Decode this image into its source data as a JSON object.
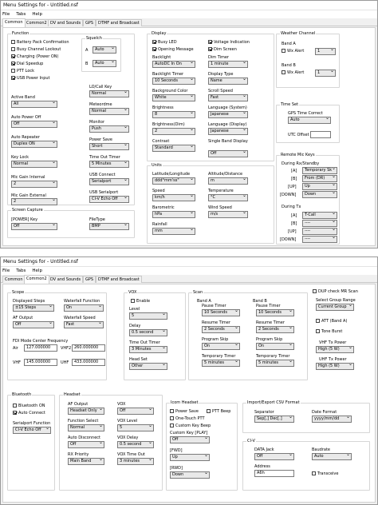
{
  "window1": {
    "title": "Menu Settings for - Untitled.nsf",
    "menu": [
      "File",
      "Tabs",
      "Help"
    ],
    "tabs": [
      "Common",
      "Common2",
      "DV and Sounds",
      "GPS",
      "DTMF and Broadcast"
    ],
    "function": {
      "title": "Function",
      "checks": [
        {
          "label": "Battery Pack Confirmation",
          "on": false
        },
        {
          "label": "Busy Channel Lockout",
          "on": false
        },
        {
          "label": "Charging (Power ON)",
          "on": true
        },
        {
          "label": "Dial Speedup",
          "on": true
        },
        {
          "label": "PTT Lock",
          "on": false
        },
        {
          "label": "USB Power Input",
          "on": true
        }
      ],
      "squelch": {
        "title": "Squelch",
        "a_label": "A",
        "a_value": "Auto",
        "b_label": "B",
        "b_value": "Auto"
      },
      "left": [
        {
          "label": "Active Band",
          "value": "All"
        },
        {
          "label": "Auto Power Off",
          "value": "Off"
        },
        {
          "label": "Auto Repeater",
          "value": "Duplex ON"
        },
        {
          "label": "Key Lock",
          "value": "Normal"
        },
        {
          "label": "Mic Gain Internal",
          "value": "2"
        },
        {
          "label": "Mic Gain External",
          "value": "2"
        }
      ],
      "right": [
        {
          "label": "LO/Call Key",
          "value": "Normal"
        },
        {
          "label": "Meteordme",
          "value": "Normal"
        },
        {
          "label": "Monitor",
          "value": "Push"
        },
        {
          "label": "Power Save",
          "value": "Short"
        },
        {
          "label": "Time Out Timer",
          "value": "5 Minutes"
        },
        {
          "label": "USB Connect",
          "value": "Serialport"
        },
        {
          "label": "USB Serialport",
          "value": "CI-V Echo Off"
        }
      ]
    },
    "screen_capture": {
      "title": "Screen Capture",
      "power_label": "[POWER] Key",
      "power_value": "Off",
      "filetype_label": "FileType",
      "filetype_value": "BMP"
    },
    "display": {
      "title": "Display",
      "checks": [
        {
          "label": "Busy LED",
          "on": true
        },
        {
          "label": "Voltage Indication",
          "on": true
        },
        {
          "label": "Opening Message",
          "on": true
        },
        {
          "label": "Dim Screen",
          "on": true
        }
      ],
      "left": [
        {
          "label": "Backlight",
          "value": "AutoDC In On"
        },
        {
          "label": "Backlight Timer",
          "value": "10 Seconds"
        },
        {
          "label": "Background Color",
          "value": "White"
        },
        {
          "label": "Brightness",
          "value": "8"
        },
        {
          "label": "Brightness(Dim)",
          "value": "2"
        },
        {
          "label": "Contrast",
          "value": "Standard"
        }
      ],
      "right": [
        {
          "label": "Dim Timer",
          "value": "1 minute"
        },
        {
          "label": "Display Type",
          "value": "Name"
        },
        {
          "label": "Scroll Speed",
          "value": "Fast"
        },
        {
          "label": "Language (System)",
          "value": "Japanese"
        },
        {
          "label": "Language (Display)",
          "value": "Japanese"
        },
        {
          "label": "Single Band Display",
          "value": "Off"
        }
      ]
    },
    "units": {
      "title": "Units",
      "left": [
        {
          "label": "Latitude/Longitude",
          "value": "ddd°mm'ss\""
        },
        {
          "label": "Speed",
          "value": "km/h"
        },
        {
          "label": "Barometric",
          "value": "hPa"
        },
        {
          "label": "Rainfall",
          "value": "mm"
        }
      ],
      "right": [
        {
          "label": "Altitude/Distance",
          "value": "m"
        },
        {
          "label": "Temperature",
          "value": "°C"
        },
        {
          "label": "Wind Speed",
          "value": "m/s"
        }
      ]
    },
    "weather": {
      "title": "Weather Channel",
      "band_a": "Band A",
      "band_b": "Band B",
      "wx_alert": "Wx Alert",
      "a_value": "1",
      "b_value": "1"
    },
    "time_set": {
      "title": "Time Set",
      "gps_label": "GPS Time Correct",
      "gps_value": "Auto",
      "utc_label": "UTC Offset",
      "utc_value": ""
    },
    "remote_mic": {
      "title": "Remote Mic Keys",
      "rx_title": "During Rx/Standby",
      "rx": [
        {
          "key": "[A]",
          "value": "Temporary Sk"
        },
        {
          "key": "[B]",
          "value": "From (DR)"
        },
        {
          "key": "[UP]",
          "value": "Up"
        },
        {
          "key": "[DOWN]",
          "value": "Down"
        }
      ],
      "tx_title": "During Tx",
      "tx": [
        {
          "key": "[A]",
          "value": "T-Call"
        },
        {
          "key": "[B]",
          "value": "----"
        },
        {
          "key": "[UP]",
          "value": "----"
        },
        {
          "key": "[DOWN]",
          "value": "----"
        }
      ]
    }
  },
  "window2": {
    "title": "Menu Settings for - Untitled.nsf",
    "menu": [
      "File",
      "Tabs",
      "Help"
    ],
    "tabs": [
      "Common",
      "Common2",
      "DV and Sounds",
      "GPS",
      "DTMF and Broadcast"
    ],
    "scope": {
      "title": "Scope",
      "steps_label": "Displayed Steps",
      "steps_value": "±15 Steps",
      "wf_func_label": "Waterfall Function",
      "wf_func_value": "On",
      "af_label": "AF Output",
      "af_value": "Off",
      "wf_speed_label": "Waterfall Speed",
      "wf_speed_value": "Fast",
      "fdi_title": "FDI Mode Center Frequency",
      "air_label": "Air",
      "air_value": "127.000000",
      "vhf2_label": "VHF2",
      "vhf2_value": "260.000000",
      "vhf_label": "VHF",
      "vhf_value": "145.000000",
      "uhf_label": "UHF",
      "uhf_value": "433.000000"
    },
    "vox": {
      "title": "VOX",
      "enable_label": "Enable",
      "enable_on": false,
      "fields": [
        {
          "label": "Level",
          "value": "5"
        },
        {
          "label": "Delay",
          "value": "0.5 second"
        },
        {
          "label": "Time Out Timer",
          "value": "3 Minutes"
        },
        {
          "label": "Head Set",
          "value": "Other"
        }
      ]
    },
    "scan": {
      "title": "Scan",
      "band_a": "Band A",
      "band_b": "Band B",
      "a": [
        {
          "label": "Pause Timer",
          "value": "10 Seconds"
        },
        {
          "label": "Resume Timer",
          "value": "2 Seconds"
        },
        {
          "label": "Program Skip",
          "value": "On"
        },
        {
          "label": "Temporary Timer",
          "value": "5 minutes"
        }
      ],
      "b": [
        {
          "label": "Pause Timer",
          "value": "10 Seconds"
        },
        {
          "label": "Resume Timer",
          "value": "2 Seconds"
        },
        {
          "label": "Program Skip",
          "value": "On"
        },
        {
          "label": "Temporary Timer",
          "value": "5 minutes"
        }
      ]
    },
    "misc": {
      "dup_label": "DUP check MR Scan",
      "dup_on": false,
      "group_label": "Select Group Range",
      "group_value": "Current Group",
      "att_label": "ATT (Band A)",
      "att_on": false,
      "tone_label": "Tone Burst",
      "tone_on": false,
      "vhf_pwr_label": "VHF Tx Power",
      "vhf_pwr_value": "High (5 W)",
      "uhf_pwr_label": "UHF Tx Power",
      "uhf_pwr_value": "High (5 W)"
    },
    "bluetooth": {
      "title": "Bluetooth",
      "bt_on_label": "Bluetooth ON",
      "bt_on": false,
      "auto_label": "Auto Connect",
      "auto_on": true,
      "serial_label": "Serialport Function",
      "serial_value": "CI-V Echo Off"
    },
    "headset": {
      "title": "Headset",
      "left": [
        {
          "label": "AF Output",
          "value": "Headset Only"
        },
        {
          "label": "Function Select",
          "value": "Normal"
        },
        {
          "label": "Auto Disconnect",
          "value": "Off"
        },
        {
          "label": "RX Priority",
          "value": "Main Band"
        }
      ],
      "right": [
        {
          "label": "VOX",
          "value": "Off"
        },
        {
          "label": "VOX Level",
          "value": "5"
        },
        {
          "label": "VOX Delay",
          "value": "0.5 second"
        },
        {
          "label": "VOX Time Out",
          "value": "3 minutes"
        }
      ]
    },
    "icom_headset": {
      "title": "Icom Headset",
      "power_save": "Power Save",
      "ptt_beep": "PTT Beep",
      "one_touch": "One-Touch PTT",
      "custom_beep": "Custom Key Beep",
      "play_label": "Custom Key [PLAY]",
      "play_value": "Off",
      "fwd_label": "[FWD]",
      "fwd_value": "Up",
      "rwd_label": "[RWD]",
      "rwd_value": "Down"
    },
    "csv": {
      "title": "Import/Export CSV Format",
      "sep_label": "Separator",
      "sep_value": "Sep[,] Dec[.]",
      "date_label": "Date Format",
      "date_value": "yyyy/mm/dd"
    },
    "civ": {
      "title": "CI-V",
      "jack_label": "DATA Jack",
      "jack_value": "Off",
      "baud_label": "Baudrate",
      "baud_value": "Auto",
      "addr_label": "Address",
      "addr_value": "A6h",
      "trans_label": "Transceive",
      "trans_on": false
    }
  }
}
